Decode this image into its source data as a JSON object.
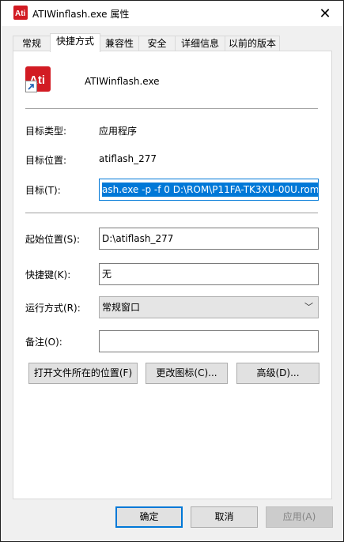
{
  "window": {
    "title": "ATIWinflash.exe 属性"
  },
  "tabs": [
    "常规",
    "快捷方式",
    "兼容性",
    "安全",
    "详细信息",
    "以前的版本"
  ],
  "active_tab": "快捷方式",
  "app": {
    "name": "ATIWinflash.exe"
  },
  "info": {
    "type_label": "目标类型:",
    "type_value": "应用程序",
    "location_label": "目标位置:",
    "location_value": "atiflash_277",
    "target_label": "目标(T):",
    "target_value": "ash.exe -p -f 0 D:\\ROM\\P11FA-TK3XU-00U.rom"
  },
  "form": {
    "start_label": "起始位置(S):",
    "start_value": "D:\\atiflash_277",
    "hotkey_label": "快捷键(K):",
    "hotkey_value": "无",
    "run_label": "运行方式(R):",
    "run_value": "常规窗口",
    "comment_label": "备注(O):",
    "comment_value": ""
  },
  "actions": {
    "open_location": "打开文件所在的位置(F)",
    "change_icon": "更改图标(C)...",
    "advanced": "高级(D)..."
  },
  "footer": {
    "ok": "确定",
    "cancel": "取消",
    "apply": "应用(A)"
  },
  "colors": {
    "accent": "#0078d7",
    "ati_red": "#d21b23"
  }
}
